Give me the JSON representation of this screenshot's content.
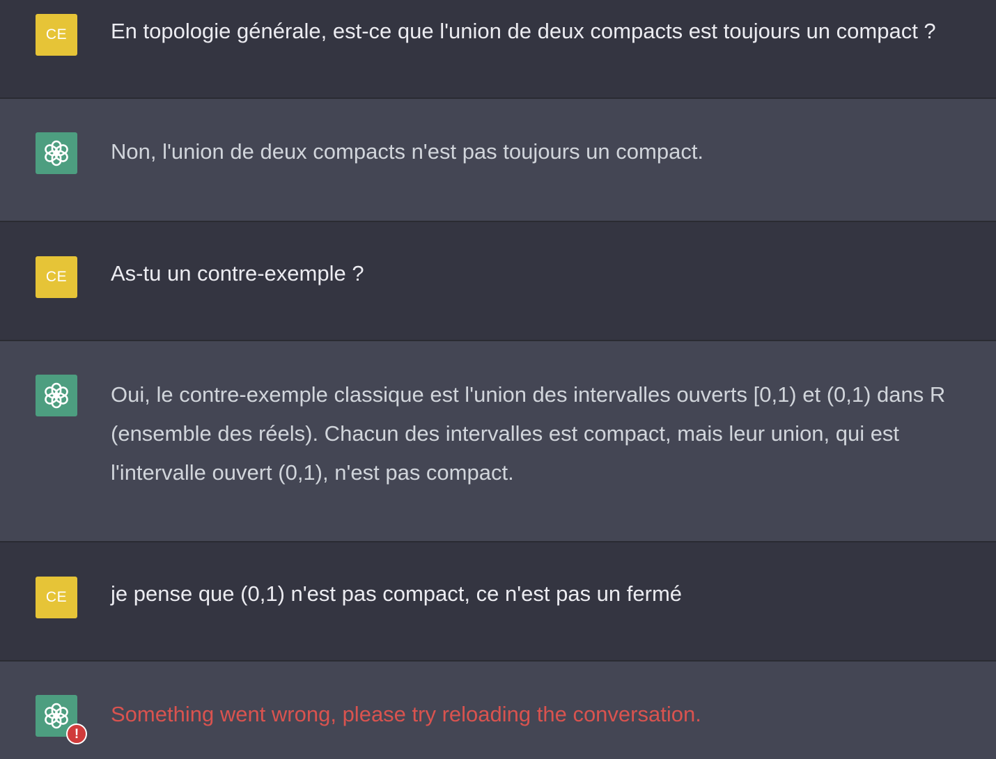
{
  "conversation": {
    "messages": [
      {
        "role": "user",
        "avatar_initials": "CE",
        "text": "En topologie générale, est-ce que l'union de deux compacts est toujours un compact ?"
      },
      {
        "role": "assistant",
        "avatar_icon": "openai-logo-icon",
        "text": "Non, l'union de deux compacts n'est pas toujours un compact."
      },
      {
        "role": "user",
        "avatar_initials": "CE",
        "text": "As-tu un contre-exemple ?"
      },
      {
        "role": "assistant",
        "avatar_icon": "openai-logo-icon",
        "text": "Oui, le contre-exemple classique est l'union des intervalles ouverts [0,1) et (0,1) dans R (ensemble des réels). Chacun des intervalles est compact, mais leur union, qui est l'intervalle ouvert (0,1), n'est pas compact."
      },
      {
        "role": "user",
        "avatar_initials": "CE",
        "text": "je pense que (0,1) n'est pas compact, ce n'est pas un fermé"
      },
      {
        "role": "assistant",
        "avatar_icon": "openai-logo-icon",
        "status_icon": "error-badge-icon",
        "error_mark": "!",
        "text": "Something went wrong, please try reloading the conversation."
      }
    ]
  },
  "colors": {
    "user_background": "#343541",
    "assistant_background": "#444654",
    "user_avatar": "#e6c437",
    "assistant_avatar": "#4d9e80",
    "error_text": "#d9534f",
    "error_badge": "#d03b3b"
  }
}
